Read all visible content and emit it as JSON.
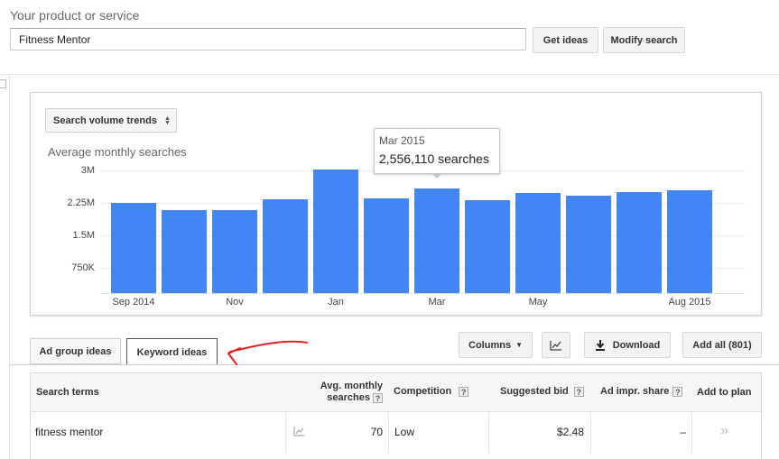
{
  "search": {
    "label": "Your product or service",
    "value": "Fitness Mentor",
    "get_ideas": "Get ideas",
    "modify": "Modify search"
  },
  "chart": {
    "dropdown_label": "Search volume trends",
    "tooltip": {
      "title": "Mar 2015",
      "value": "2,556,110 searches"
    }
  },
  "chart_data": {
    "type": "bar",
    "ylabel": "Average monthly searches",
    "ylim": [
      0,
      3000000
    ],
    "yticks": [
      "750K",
      "1.5M",
      "2.25M",
      "3M"
    ],
    "ytick_values": [
      750000,
      1500000,
      2250000,
      3000000
    ],
    "categories": [
      "Sep 2014",
      "Oct 2014",
      "Nov 2014",
      "Dec 2014",
      "Jan 2015",
      "Feb 2015",
      "Mar 2015",
      "Apr 2015",
      "May 2015",
      "Jun 2015",
      "Jul 2015",
      "Aug 2015"
    ],
    "xtick_labels": [
      "Sep 2014",
      "",
      "Nov",
      "",
      "Jan",
      "",
      "Mar",
      "",
      "May",
      "",
      "",
      "Aug 2015"
    ],
    "values": [
      2200000,
      2040000,
      2020000,
      2290000,
      3020000,
      2310000,
      2556110,
      2270000,
      2450000,
      2390000,
      2460000,
      2520000
    ],
    "grid": true,
    "highlight_index": 6
  },
  "toolbar": {
    "tabs": [
      {
        "label": "Ad group ideas"
      },
      {
        "label": "Keyword ideas"
      }
    ],
    "columns": "Columns",
    "download": "Download",
    "add_all": "Add all (801)"
  },
  "table": {
    "headers": {
      "terms": "Search terms",
      "avg1": "Avg. monthly",
      "avg2": "searches",
      "competition": "Competition",
      "bid": "Suggested bid",
      "impr": "Ad impr. share",
      "add": "Add to plan"
    },
    "rows": [
      {
        "term": "fitness mentor",
        "avg": "70",
        "competition": "Low",
        "bid": "$2.48",
        "impr": "–",
        "add": "»"
      }
    ]
  },
  "colors": {
    "bar": "#4285f4",
    "annotation": "#e02020"
  }
}
